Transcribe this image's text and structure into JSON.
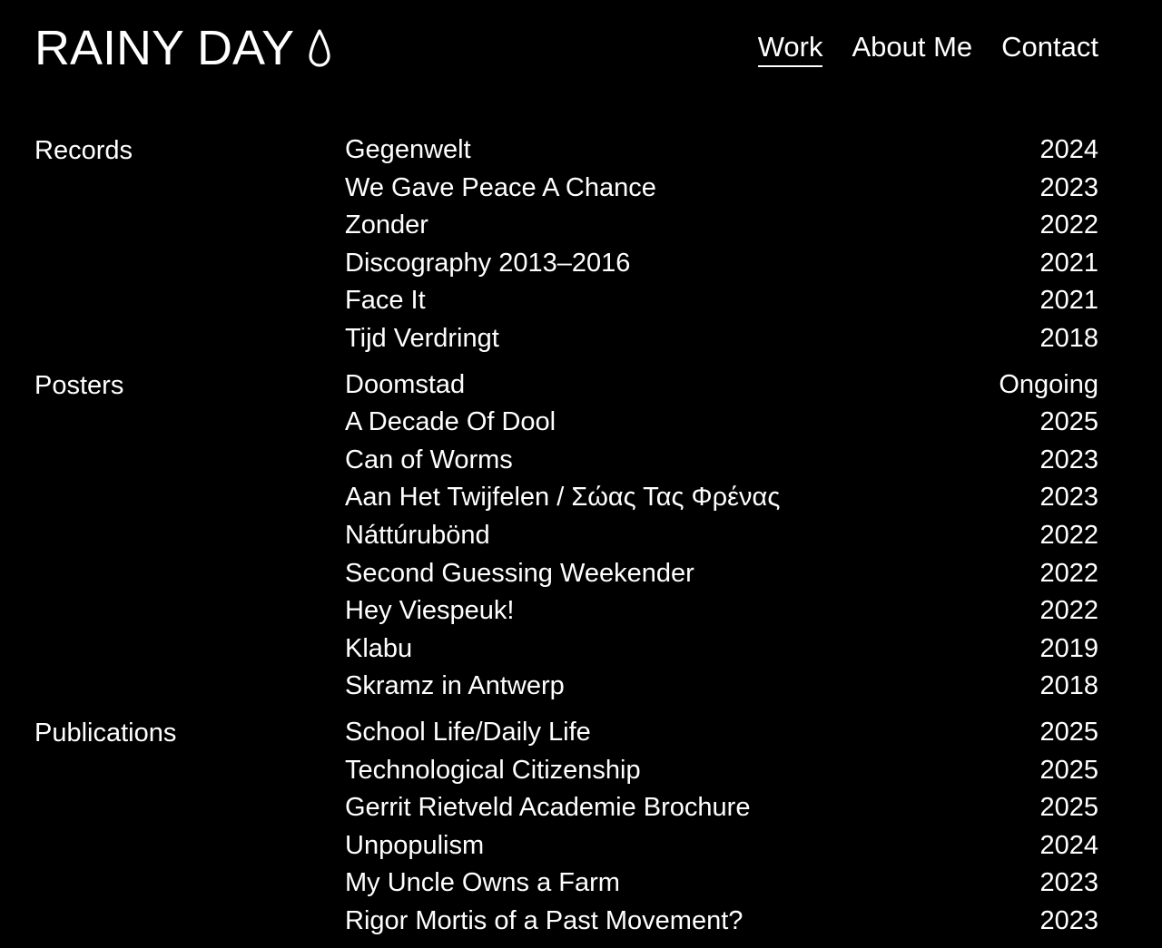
{
  "logo": {
    "text": "RAINY DAY",
    "icon": "raindrop-icon"
  },
  "nav": [
    {
      "label": "Work",
      "active": true
    },
    {
      "label": "About Me",
      "active": false
    },
    {
      "label": "Contact",
      "active": false
    }
  ],
  "sections": [
    {
      "label": "Records",
      "items": [
        {
          "title": "Gegenwelt",
          "year": "2024"
        },
        {
          "title": "We Gave Peace A Chance",
          "year": "2023"
        },
        {
          "title": "Zonder",
          "year": "2022"
        },
        {
          "title": "Discography 2013–2016",
          "year": "2021"
        },
        {
          "title": "Face It",
          "year": "2021"
        },
        {
          "title": "Tijd Verdringt",
          "year": "2018"
        }
      ]
    },
    {
      "label": "Posters",
      "items": [
        {
          "title": "Doomstad",
          "year": "Ongoing"
        },
        {
          "title": "A Decade Of Dool",
          "year": "2025"
        },
        {
          "title": "Can of Worms",
          "year": "2023"
        },
        {
          "title": "Aan Het Twijfelen / Σώας Τας Φρένας",
          "year": "2023"
        },
        {
          "title": "Náttúrubönd",
          "year": "2022"
        },
        {
          "title": "Second Guessing Weekender",
          "year": "2022"
        },
        {
          "title": "Hey Viespeuk!",
          "year": "2022"
        },
        {
          "title": "Klabu",
          "year": "2019"
        },
        {
          "title": "Skramz in Antwerp",
          "year": "2018"
        }
      ]
    },
    {
      "label": "Publications",
      "items": [
        {
          "title": "School Life/Daily Life",
          "year": "2025"
        },
        {
          "title": "Technological Citizenship",
          "year": "2025"
        },
        {
          "title": "Gerrit Rietveld Academie Brochure",
          "year": "2025"
        },
        {
          "title": "Unpopulism",
          "year": "2024"
        },
        {
          "title": "My Uncle Owns a Farm",
          "year": "2023"
        },
        {
          "title": "Rigor Mortis of a Past Movement?",
          "year": "2023"
        }
      ]
    }
  ],
  "colors": {
    "background": "#000000",
    "text": "#ffffff"
  }
}
